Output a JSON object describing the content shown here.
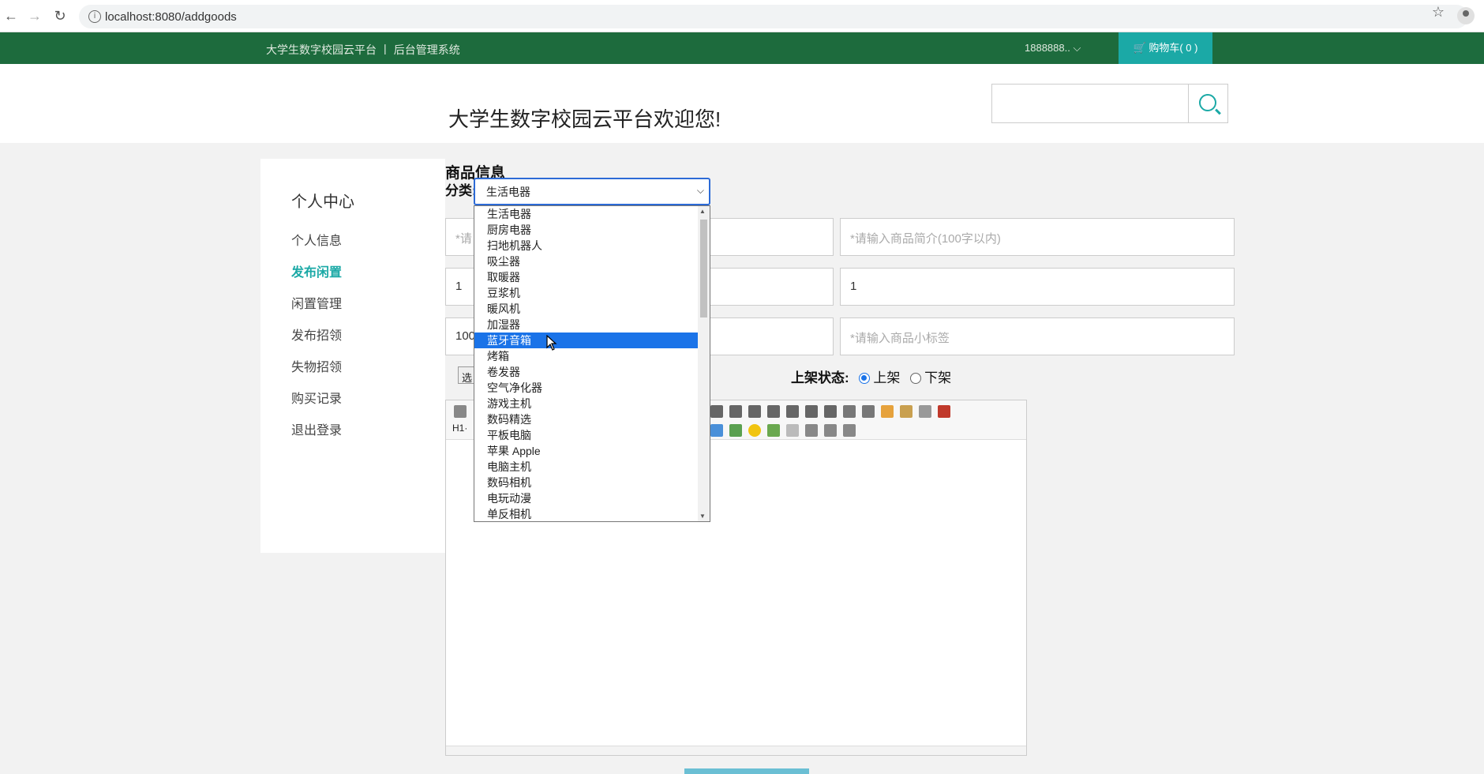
{
  "browser": {
    "url": "localhost:8080/addgoods"
  },
  "topnav": {
    "brand": "大学生数字校园云平台 丨 后台管理系统",
    "user": "1888888.. ⌵",
    "cart": "购物车( 0 )"
  },
  "header": {
    "welcome": "大学生数字校园云平台欢迎您!",
    "search_placeholder": ""
  },
  "sidebar": {
    "title": "个人中心",
    "items": [
      {
        "label": "个人信息",
        "active": false
      },
      {
        "label": "发布闲置",
        "active": true
      },
      {
        "label": "闲置管理",
        "active": false
      },
      {
        "label": "发布招领",
        "active": false
      },
      {
        "label": "失物招领",
        "active": false
      },
      {
        "label": "购买记录",
        "active": false
      },
      {
        "label": "退出登录",
        "active": false
      }
    ]
  },
  "form": {
    "section_title": "商品信息",
    "category_label": "分类:",
    "category_value": "生活电器",
    "name_placeholder_visible": "*请",
    "intro_placeholder": "*请输入商品简介(100字以内)",
    "left_value_1": "1",
    "right_value_1": "1",
    "left_value_2": "100",
    "tag_placeholder": "*请输入商品小标签",
    "choose_label": "选",
    "status_label": "上架状态:",
    "status_on": "上架",
    "status_off": "下架",
    "heading_selector": "H1·"
  },
  "dropdown": {
    "selected": "蓝牙音箱",
    "options": [
      "生活电器",
      "厨房电器",
      "扫地机器人",
      "吸尘器",
      "取暖器",
      "豆浆机",
      "暖风机",
      "加湿器",
      "蓝牙音箱",
      "烤箱",
      "卷发器",
      "空气净化器",
      "游戏主机",
      "数码精选",
      "平板电脑",
      "苹果 Apple",
      "电脑主机",
      "数码相机",
      "电玩动漫",
      "单反相机"
    ]
  },
  "colors": {
    "topnav_bg": "#1d6b3d",
    "accent": "#1ba9a6",
    "selection": "#1a73e8"
  }
}
